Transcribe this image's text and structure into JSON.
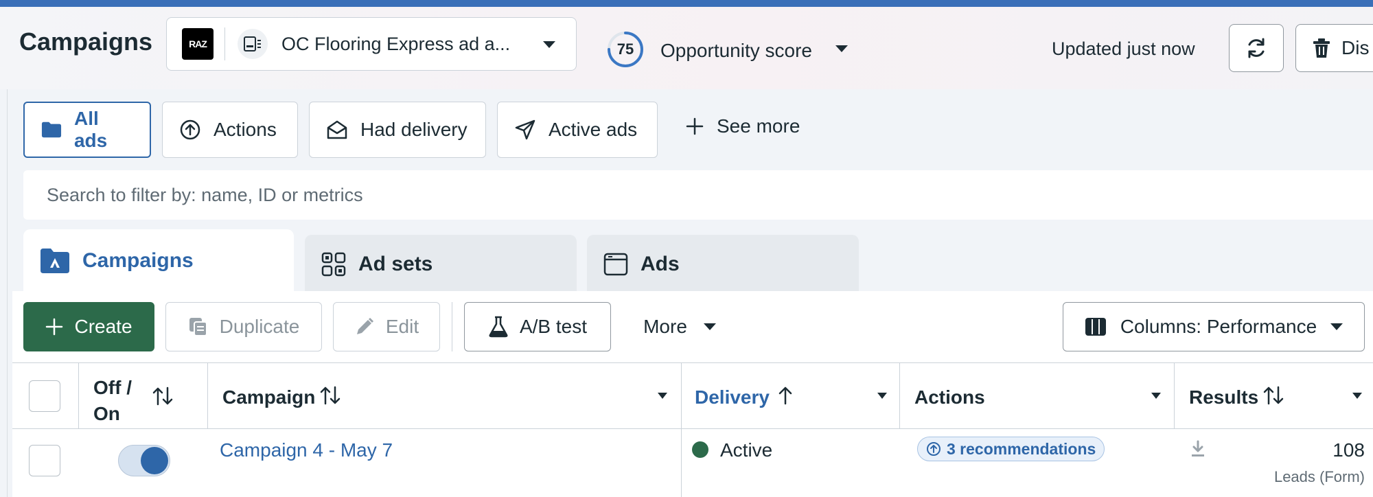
{
  "header": {
    "title": "Campaigns",
    "account_logo_text": "RAZ",
    "account_name": "OC Flooring Express ad a...",
    "opportunity_score": "75",
    "opportunity_score_fraction": 0.75,
    "opportunity_label": "Opportunity score",
    "updated": "Updated just now",
    "discard_label": "Dis"
  },
  "filters": {
    "all_ads": "All ads",
    "actions": "Actions",
    "had_delivery": "Had delivery",
    "active_ads": "Active ads",
    "see_more": "See more"
  },
  "search": {
    "placeholder": "Search to filter by: name, ID or metrics"
  },
  "tabs": {
    "campaigns": "Campaigns",
    "ad_sets": "Ad sets",
    "ads": "Ads"
  },
  "toolbar": {
    "create": "Create",
    "duplicate": "Duplicate",
    "edit": "Edit",
    "ab_test": "A/B test",
    "more": "More",
    "columns": "Columns: Performance"
  },
  "table": {
    "headers": {
      "off_on_line1": "Off /",
      "off_on_line2": "On",
      "campaign": "Campaign",
      "delivery": "Delivery",
      "actions": "Actions",
      "results": "Results"
    },
    "rows": [
      {
        "campaign": "Campaign 4 - May 7",
        "delivery": "Active",
        "actions": "3 recommendations",
        "results": "108",
        "results_sub": "Leads (Form)"
      }
    ]
  },
  "colors": {
    "accent": "#2e66a8",
    "create_green": "#2c6a4a",
    "active_green": "#2c6a4a",
    "top_bar": "#3a6fb8"
  }
}
